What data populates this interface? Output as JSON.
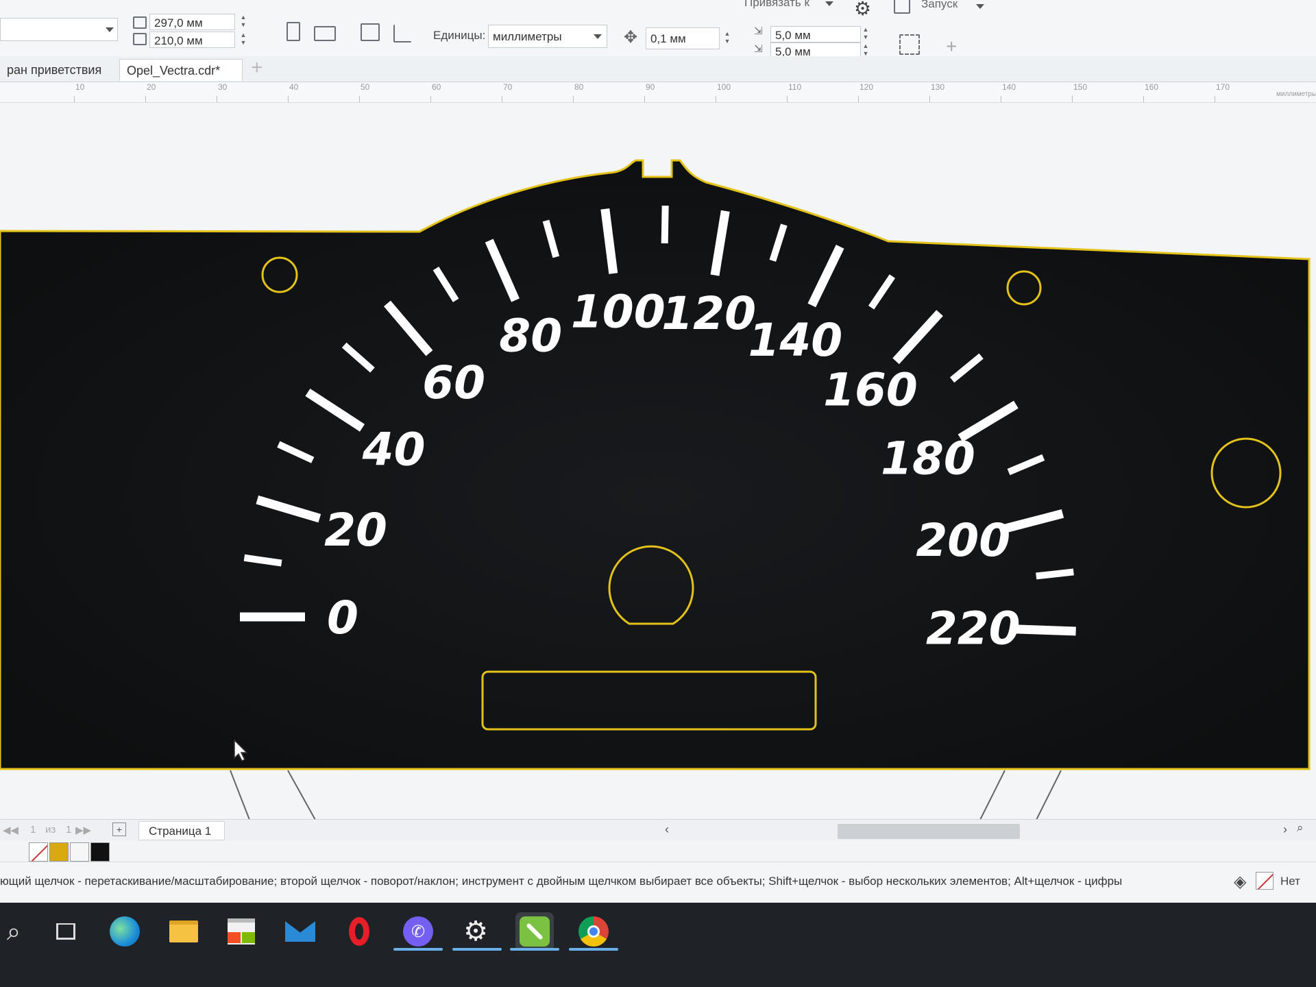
{
  "toolbar": {
    "page_width": "297,0 мм",
    "page_height": "210,0 мм",
    "units_label": "Единицы:",
    "units_value": "миллиметры",
    "nudge_value": "0,1 мм",
    "dup_x": "5,0 мм",
    "dup_y": "5,0 мм",
    "snap_label": "Привязать к",
    "launch_label": "Запуск"
  },
  "tabs": [
    {
      "label": "ран приветствия"
    },
    {
      "label": "Opel_Vectra.cdr*"
    }
  ],
  "ruler": {
    "ticks": [
      "10",
      "20",
      "30",
      "40",
      "50",
      "60",
      "70",
      "80",
      "90",
      "100",
      "110",
      "120",
      "130",
      "140",
      "150",
      "160",
      "170"
    ],
    "unit": "миллиметры"
  },
  "gauge": {
    "labels": [
      "0",
      "20",
      "40",
      "60",
      "80",
      "100",
      "120",
      "140",
      "160",
      "180",
      "200",
      "220"
    ],
    "min": 0,
    "max": 220,
    "colors": {
      "face": "#121212",
      "outline": "#e3c21a",
      "text": "#ffffff"
    }
  },
  "pager": {
    "current": "1",
    "of_label": "из",
    "total": "1",
    "page_tab": "Страница 1"
  },
  "palette": {
    "swatches": [
      "none",
      "#d9aa10",
      "#f6f6f6",
      "#111111"
    ]
  },
  "status": {
    "hint": "ющий щелчок - перетаскивание/масштабирование; второй щелчок - поворот/наклон; инструмент с двойным щелчком выбирает все объекты; Shift+щелчок - выбор нескольких элементов; Alt+щелчок - цифры",
    "fill_none": "Нет"
  },
  "taskbar": {
    "apps": [
      "search-icon",
      "task-view-icon",
      "edge-icon",
      "file-explorer-icon",
      "store-icon",
      "mail-icon",
      "opera-icon",
      "viber-icon",
      "settings-icon",
      "coreldraw-icon",
      "chrome-icon"
    ]
  }
}
